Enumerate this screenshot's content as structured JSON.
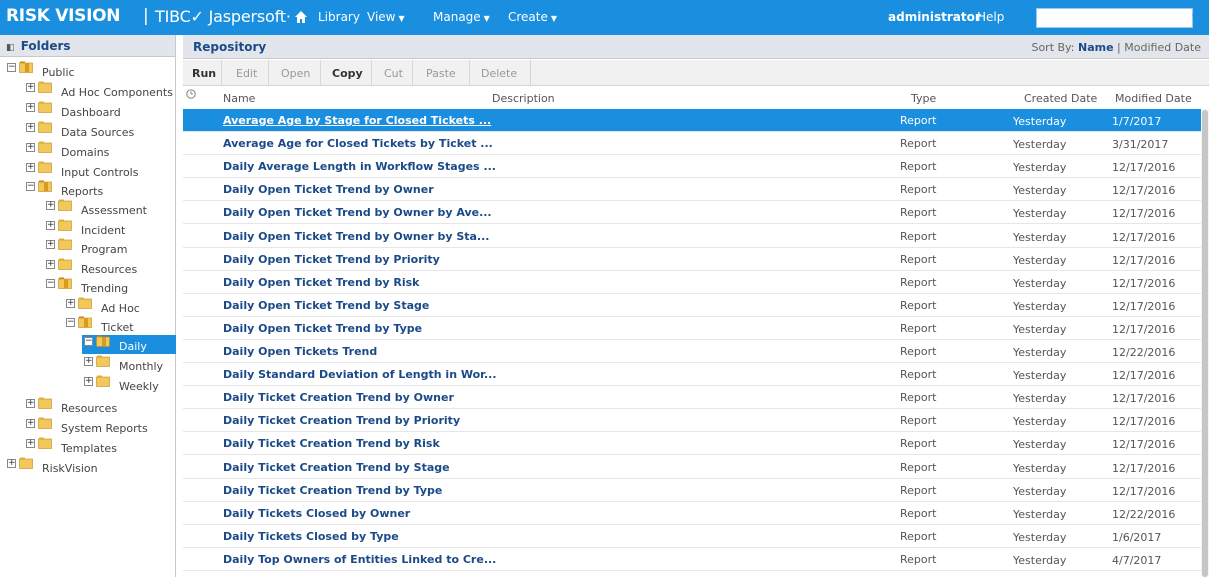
{
  "app": {
    "brand_primary": "RISK VISION",
    "brand_secondary": "TIBC✓ Jaspersoft·",
    "accent": "#1a8fe0",
    "link_color": "#1b4a88"
  },
  "topnav": {
    "home_icon": "home-icon",
    "library": "Library",
    "view": "View",
    "manage": "Manage",
    "create": "Create",
    "user": "administrator",
    "help": "Help",
    "search_value": "",
    "search_icon": "search-icon"
  },
  "folders": {
    "title": "Folders",
    "tree": [
      {
        "label": "Public",
        "exp": "−",
        "open": true
      },
      {
        "label": "Ad Hoc Components",
        "exp": "+"
      },
      {
        "label": "Dashboard",
        "exp": "+"
      },
      {
        "label": "Data Sources",
        "exp": "+"
      },
      {
        "label": "Domains",
        "exp": "+"
      },
      {
        "label": "Input Controls",
        "exp": "+"
      },
      {
        "label": "Reports",
        "exp": "−",
        "open": true
      },
      {
        "label": "Assessment",
        "exp": "+"
      },
      {
        "label": "Incident",
        "exp": "+"
      },
      {
        "label": "Program",
        "exp": "+"
      },
      {
        "label": "Resources",
        "exp": "+"
      },
      {
        "label": "Trending",
        "exp": "−",
        "open": true
      },
      {
        "label": "Ad Hoc",
        "exp": "+"
      },
      {
        "label": "Ticket",
        "exp": "−",
        "open": true
      },
      {
        "label": "Daily",
        "exp": "−",
        "open": true,
        "selected": true
      },
      {
        "label": "Monthly",
        "exp": "+"
      },
      {
        "label": "Weekly",
        "exp": "+"
      },
      {
        "label": "Resources",
        "exp": "+"
      },
      {
        "label": "System Reports",
        "exp": "+"
      },
      {
        "label": "Templates",
        "exp": "+"
      },
      {
        "label": "RiskVision",
        "exp": "+"
      }
    ]
  },
  "repository": {
    "title": "Repository",
    "sort_by_label": "Sort By:",
    "sort_name": "Name",
    "sort_divider": "|",
    "sort_modified": "Modified Date",
    "toolbar": {
      "run": "Run",
      "edit": "Edit",
      "open": "Open",
      "copy": "Copy",
      "cut": "Cut",
      "paste": "Paste",
      "delete": "Delete"
    },
    "columns": {
      "name": "Name",
      "description": "Description",
      "type": "Type",
      "created": "Created Date",
      "modified": "Modified Date"
    },
    "rows": [
      {
        "name": "Average Age by Stage for Closed Tickets ...",
        "type": "Report",
        "created": "Yesterday",
        "modified": "1/7/2017",
        "selected": true
      },
      {
        "name": "Average Age for Closed Tickets by Ticket ...",
        "type": "Report",
        "created": "Yesterday",
        "modified": "3/31/2017"
      },
      {
        "name": "Daily Average Length in Workflow Stages ...",
        "type": "Report",
        "created": "Yesterday",
        "modified": "12/17/2016"
      },
      {
        "name": "Daily Open Ticket Trend by Owner",
        "type": "Report",
        "created": "Yesterday",
        "modified": "12/17/2016"
      },
      {
        "name": "Daily Open Ticket Trend by Owner by Ave...",
        "type": "Report",
        "created": "Yesterday",
        "modified": "12/17/2016"
      },
      {
        "name": "Daily Open Ticket Trend by Owner by Sta...",
        "type": "Report",
        "created": "Yesterday",
        "modified": "12/17/2016"
      },
      {
        "name": "Daily Open Ticket Trend by Priority",
        "type": "Report",
        "created": "Yesterday",
        "modified": "12/17/2016"
      },
      {
        "name": "Daily Open Ticket Trend by Risk",
        "type": "Report",
        "created": "Yesterday",
        "modified": "12/17/2016"
      },
      {
        "name": "Daily Open Ticket Trend by Stage",
        "type": "Report",
        "created": "Yesterday",
        "modified": "12/17/2016"
      },
      {
        "name": "Daily Open Ticket Trend by Type",
        "type": "Report",
        "created": "Yesterday",
        "modified": "12/17/2016"
      },
      {
        "name": "Daily Open Tickets Trend",
        "type": "Report",
        "created": "Yesterday",
        "modified": "12/22/2016"
      },
      {
        "name": "Daily Standard Deviation of Length in Wor...",
        "type": "Report",
        "created": "Yesterday",
        "modified": "12/17/2016"
      },
      {
        "name": "Daily Ticket Creation Trend by Owner",
        "type": "Report",
        "created": "Yesterday",
        "modified": "12/17/2016"
      },
      {
        "name": "Daily Ticket Creation Trend by Priority",
        "type": "Report",
        "created": "Yesterday",
        "modified": "12/17/2016"
      },
      {
        "name": "Daily Ticket Creation Trend by Risk",
        "type": "Report",
        "created": "Yesterday",
        "modified": "12/17/2016"
      },
      {
        "name": "Daily Ticket Creation Trend by Stage",
        "type": "Report",
        "created": "Yesterday",
        "modified": "12/17/2016"
      },
      {
        "name": "Daily Ticket Creation Trend by Type",
        "type": "Report",
        "created": "Yesterday",
        "modified": "12/17/2016"
      },
      {
        "name": "Daily Tickets Closed by Owner",
        "type": "Report",
        "created": "Yesterday",
        "modified": "12/22/2016"
      },
      {
        "name": "Daily Tickets Closed by Type",
        "type": "Report",
        "created": "Yesterday",
        "modified": "1/6/2017"
      },
      {
        "name": "Daily Top Owners of Entities Linked to Cre...",
        "type": "Report",
        "created": "Yesterday",
        "modified": "4/7/2017"
      }
    ]
  }
}
